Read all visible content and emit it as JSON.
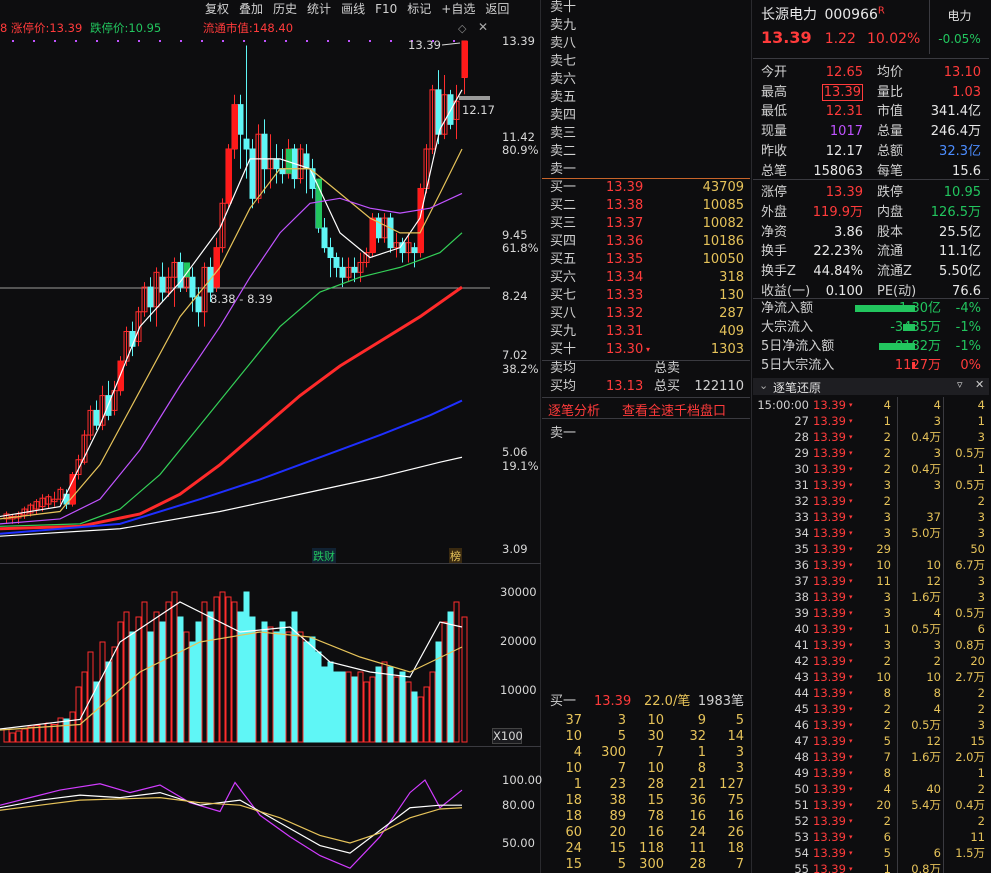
{
  "toolbar": [
    "复权",
    "叠加",
    "历史",
    "统计",
    "画线",
    "F10",
    "标记",
    "+自选",
    "返回"
  ],
  "info": {
    "limit_up_label": "涨停价:",
    "limit_up": "13.39",
    "limit_down_label": "跌停价:",
    "limit_down": "10.95",
    "float_mv_label": "流通市值:",
    "float_mv": "148.40",
    "left_fragment": "8"
  },
  "price_axis": [
    {
      "t": "13.39"
    },
    {
      "t": "11.42"
    },
    {
      "t": "80.9%"
    },
    {
      "t": "9.45"
    },
    {
      "t": "61.8%"
    },
    {
      "t": "8.24"
    },
    {
      "t": "7.02"
    },
    {
      "t": "38.2%"
    },
    {
      "t": "5.06"
    },
    {
      "t": "19.1%"
    },
    {
      "t": "3.09"
    }
  ],
  "chart_labels": {
    "high_mark": "13.39",
    "side_price": "12.17",
    "range_label": "8.38 - 8.39",
    "tag_finance": "跌财",
    "tag_rank": "榜"
  },
  "vol_axis": [
    "30000",
    "20000",
    "10000"
  ],
  "vol_unit": "X100",
  "ind_axis": [
    "100.00",
    "80.00",
    "50.00"
  ],
  "book": {
    "asks": [
      "卖十",
      "卖九",
      "卖八",
      "卖七",
      "卖六",
      "卖五",
      "卖四",
      "卖三",
      "卖二",
      "卖一"
    ],
    "bids": [
      {
        "l": "买一",
        "p": "13.39",
        "v": "43709"
      },
      {
        "l": "买二",
        "p": "13.38",
        "v": "10085"
      },
      {
        "l": "买三",
        "p": "13.37",
        "v": "10082"
      },
      {
        "l": "买四",
        "p": "13.36",
        "v": "10186"
      },
      {
        "l": "买五",
        "p": "13.35",
        "v": "10050"
      },
      {
        "l": "买六",
        "p": "13.34",
        "v": "318"
      },
      {
        "l": "买七",
        "p": "13.33",
        "v": "130"
      },
      {
        "l": "买八",
        "p": "13.32",
        "v": "287"
      },
      {
        "l": "买九",
        "p": "13.31",
        "v": "409"
      },
      {
        "l": "买十",
        "p": "13.30",
        "v": "1303"
      }
    ],
    "sell_avg_label": "卖均",
    "total_sell_label": "总卖",
    "buy_avg_label": "买均",
    "buy_avg": "13.13",
    "total_buy_label": "总买",
    "total_buy": "122110",
    "tab1": "逐笔分析",
    "tab2": "查看全速千档盘口",
    "queue_header": "卖一",
    "buy1_line": {
      "l": "买一",
      "p": "13.39",
      "avg": "22.0/笔",
      "cnt": "1983笔"
    },
    "queue": [
      [
        "37",
        "3",
        "10",
        "9",
        "5"
      ],
      [
        "10",
        "5",
        "30",
        "32",
        "14"
      ],
      [
        "4",
        "300",
        "7",
        "1",
        "3"
      ],
      [
        "10",
        "7",
        "10",
        "8",
        "3"
      ],
      [
        "1",
        "23",
        "28",
        "21",
        "127"
      ],
      [
        "18",
        "38",
        "15",
        "36",
        "75"
      ],
      [
        "18",
        "89",
        "78",
        "16",
        "16"
      ],
      [
        "60",
        "20",
        "16",
        "24",
        "26"
      ],
      [
        "24",
        "15",
        "118",
        "11",
        "18"
      ],
      [
        "15",
        "5",
        "300",
        "28",
        "7"
      ]
    ]
  },
  "quote": {
    "name": "长源电力",
    "code": "000966",
    "badge": "R",
    "price": "13.39",
    "change": "1.22",
    "pct": "10.02%",
    "sector": "电力",
    "sector_pct": "-0.05%",
    "rows": [
      {
        "a": "今开",
        "av": "12.65",
        "ac": "red",
        "b": "均价",
        "bv": "13.10",
        "bc": "red"
      },
      {
        "a": "最高",
        "av": "13.39",
        "ac": "red",
        "b": "量比",
        "bv": "1.03",
        "bc": "red"
      },
      {
        "a": "最低",
        "av": "12.31",
        "ac": "red",
        "b": "市值",
        "bv": "341.4亿",
        "bc": "white"
      },
      {
        "a": "现量",
        "av": "1017",
        "ac": "purple",
        "b": "总量",
        "bv": "246.4万",
        "bc": "white"
      },
      {
        "a": "昨收",
        "av": "12.17",
        "ac": "white",
        "b": "总额",
        "bv": "32.3亿",
        "bc": "blue"
      },
      {
        "a": "总笔",
        "av": "158063",
        "ac": "white",
        "b": "每笔",
        "bv": "15.6",
        "bc": "white"
      },
      {
        "a": "涨停",
        "av": "13.39",
        "ac": "red",
        "b": "跌停",
        "bv": "10.95",
        "bc": "green"
      },
      {
        "a": "外盘",
        "av": "119.9万",
        "ac": "red",
        "b": "内盘",
        "bv": "126.5万",
        "bc": "green"
      },
      {
        "a": "净资",
        "av": "3.86",
        "ac": "white",
        "b": "股本",
        "bv": "25.5亿",
        "bc": "white"
      },
      {
        "a": "换手",
        "av": "22.23%",
        "ac": "white",
        "b": "流通",
        "bv": "11.1亿",
        "bc": "white"
      },
      {
        "a": "换手Z",
        "av": "44.84%",
        "ac": "white",
        "b": "流通Z",
        "bv": "5.50亿",
        "bc": "white"
      },
      {
        "a": "收益(一)",
        "av": "0.100",
        "ac": "white",
        "b": "PE(动)",
        "bv": "76.6",
        "bc": "white"
      }
    ],
    "flows": [
      {
        "l": "净流入额",
        "v": "-1.30亿",
        "p": "-4%",
        "c": "green",
        "bar": 1.0
      },
      {
        "l": "大宗流入",
        "v": "-3435万",
        "p": "-1%",
        "c": "green",
        "bar": 0.2
      },
      {
        "l": "5日净流入额",
        "v": "-8182万",
        "p": "-1%",
        "c": "green",
        "bar": 0.6
      },
      {
        "l": "5日大宗流入",
        "v": "1127万",
        "p": "0%",
        "c": "red",
        "bar": 0.05
      }
    ],
    "tick_title": "逐笔还原",
    "ticks": [
      {
        "t": "15:00:00",
        "p": "13.39",
        "v": "4",
        "a": "4",
        "b": "4"
      },
      {
        "t": "27",
        "p": "13.39",
        "v": "1",
        "a": "3",
        "b": "1"
      },
      {
        "t": "28",
        "p": "13.39",
        "v": "2",
        "a": "0.4万",
        "b": "3"
      },
      {
        "t": "29",
        "p": "13.39",
        "v": "2",
        "a": "3",
        "b": "0.5万"
      },
      {
        "t": "30",
        "p": "13.39",
        "v": "2",
        "a": "0.4万",
        "b": "1"
      },
      {
        "t": "31",
        "p": "13.39",
        "v": "3",
        "a": "3",
        "b": "0.5万"
      },
      {
        "t": "32",
        "p": "13.39",
        "v": "2",
        "a": "",
        "b": "2"
      },
      {
        "t": "33",
        "p": "13.39",
        "v": "3",
        "a": "37",
        "b": "3"
      },
      {
        "t": "34",
        "p": "13.39",
        "v": "3",
        "a": "5.0万",
        "b": "3"
      },
      {
        "t": "35",
        "p": "13.39",
        "v": "29",
        "a": "",
        "b": "50"
      },
      {
        "t": "36",
        "p": "13.39",
        "v": "10",
        "a": "10",
        "b": "6.7万"
      },
      {
        "t": "37",
        "p": "13.39",
        "v": "11",
        "a": "12",
        "b": "3"
      },
      {
        "t": "38",
        "p": "13.39",
        "v": "3",
        "a": "1.6万",
        "b": "3"
      },
      {
        "t": "39",
        "p": "13.39",
        "v": "3",
        "a": "4",
        "b": "0.5万"
      },
      {
        "t": "40",
        "p": "13.39",
        "v": "1",
        "a": "0.5万",
        "b": "6"
      },
      {
        "t": "41",
        "p": "13.39",
        "v": "3",
        "a": "3",
        "b": "0.8万"
      },
      {
        "t": "42",
        "p": "13.39",
        "v": "2",
        "a": "2",
        "b": "20"
      },
      {
        "t": "43",
        "p": "13.39",
        "v": "10",
        "a": "10",
        "b": "2.7万"
      },
      {
        "t": "44",
        "p": "13.39",
        "v": "8",
        "a": "8",
        "b": "2"
      },
      {
        "t": "45",
        "p": "13.39",
        "v": "2",
        "a": "4",
        "b": "2"
      },
      {
        "t": "46",
        "p": "13.39",
        "v": "2",
        "a": "0.5万",
        "b": "3"
      },
      {
        "t": "47",
        "p": "13.39",
        "v": "5",
        "a": "12",
        "b": "15"
      },
      {
        "t": "48",
        "p": "13.39",
        "v": "7",
        "a": "1.6万",
        "b": "2.0万"
      },
      {
        "t": "49",
        "p": "13.39",
        "v": "8",
        "a": "",
        "b": "1"
      },
      {
        "t": "50",
        "p": "13.39",
        "v": "4",
        "a": "40",
        "b": "2"
      },
      {
        "t": "51",
        "p": "13.39",
        "v": "20",
        "a": "5.4万",
        "b": "0.4万"
      },
      {
        "t": "52",
        "p": "13.39",
        "v": "2",
        "a": "",
        "b": "2"
      },
      {
        "t": "53",
        "p": "13.39",
        "v": "6",
        "a": "",
        "b": "11"
      },
      {
        "t": "54",
        "p": "13.39",
        "v": "5",
        "a": "6",
        "b": "1.5万"
      },
      {
        "t": "55",
        "p": "13.39",
        "v": "1",
        "a": "0.8万",
        "b": ""
      }
    ]
  },
  "colors": {
    "up": "#ff3b3b",
    "down": "#22c55e",
    "vol_up": "#ff3b3b",
    "vol_down": "#5ff6f6",
    "bg": "#0d0d0f"
  }
}
